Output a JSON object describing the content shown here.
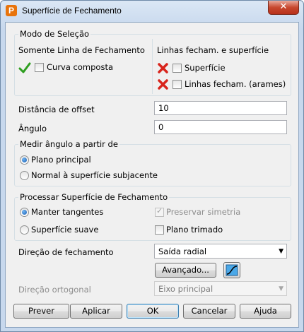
{
  "window": {
    "title": "Superfície de Fechamento",
    "app_icon_letter": "P",
    "close_glyph": "✕"
  },
  "selection_mode": {
    "group_title": "Modo de Seleção",
    "left_heading": "Somente Linha de Fechamento",
    "right_heading": "Linhas fecham. e superfície",
    "composite_curve_label": "Curva composta",
    "surface_label": "Superfície",
    "wireframe_label": "Linhas fecham. (arames)"
  },
  "offset": {
    "label": "Distância de offset",
    "value": "10"
  },
  "angle": {
    "label": "Ângulo",
    "value": "0"
  },
  "measure_angle": {
    "group_title": "Medir ângulo a partir de",
    "option_principal": "Plano principal",
    "option_normal": "Normal à superfície subjacente"
  },
  "process": {
    "group_title": "Processar Superfície de Fechamento",
    "keep_tangents": "Manter tangentes",
    "smooth_surface": "Superfície suave",
    "preserve_symmetry": "Preservar simetria",
    "trimmed_plane": "Plano trimado"
  },
  "closing_direction": {
    "label": "Direção de fechamento",
    "value": "Saída radial"
  },
  "advanced_button": "Avançado...",
  "orthogonal_direction": {
    "label": "Direção ortogonal",
    "value": "Eixo principal"
  },
  "footer": {
    "preview": "Prever",
    "apply": "Aplicar",
    "ok": "OK",
    "cancel": "Cancelar",
    "help": "Ajuda"
  },
  "colors": {
    "check_green": "#2e9e1f",
    "cross_red": "#d8241c",
    "title_bar": "#c7d8ed"
  }
}
